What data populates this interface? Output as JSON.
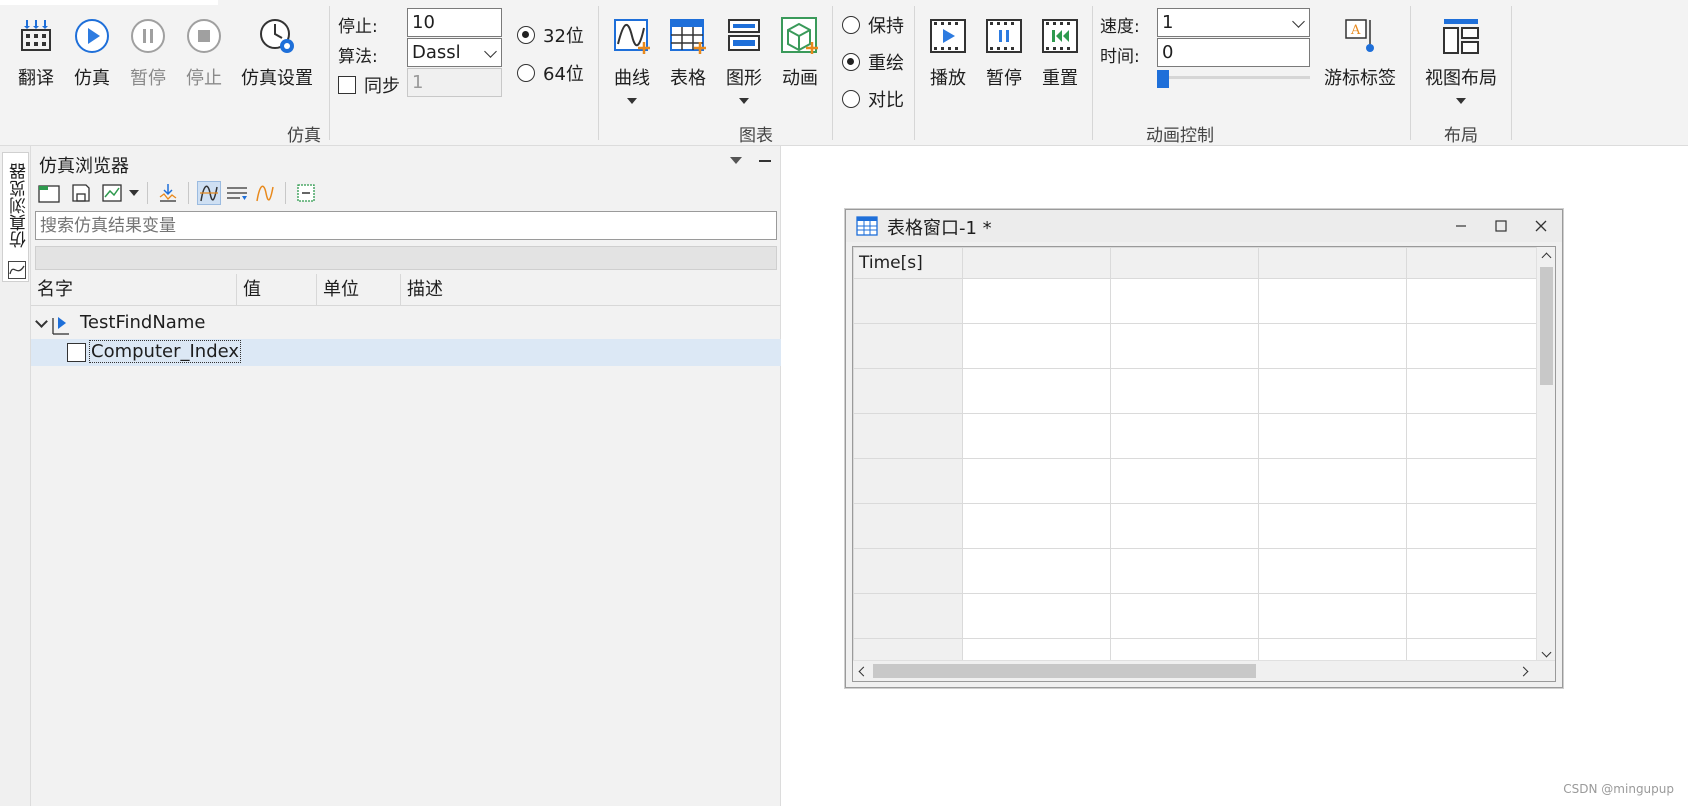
{
  "ribbon": {
    "sim": {
      "translate_label": "翻译",
      "simulate_label": "仿真",
      "pause_label": "暂停",
      "stop_label": "停止",
      "settings_label": "仿真设置",
      "stop_time_label": "停止:",
      "stop_time_value": "10",
      "algorithm_label": "算法:",
      "algorithm_value": "Dassl",
      "sync_label": "同步",
      "sync_value": "1",
      "radio_32": "32位",
      "radio_64": "64位",
      "group_label": "仿真"
    },
    "chart": {
      "curve_label": "曲线",
      "table_label": "表格",
      "graphic_label": "图形",
      "animation_label": "动画",
      "keep_label": "保持",
      "redraw_label": "重绘",
      "compare_label": "对比",
      "group_label": "图表"
    },
    "anim": {
      "play_label": "播放",
      "pause_label": "暂停",
      "reset_label": "重置",
      "speed_label": "速度:",
      "speed_value": "1",
      "time_label": "时间:",
      "time_value": "0",
      "cursor_label": "游标标签",
      "group_label": "动画控制"
    },
    "layout": {
      "view_layout_label": "视图布局",
      "group_label": "布局"
    }
  },
  "side_tab": {
    "label": "仿真浏览器"
  },
  "browser": {
    "title": "仿真浏览器",
    "search_placeholder": "搜索仿真结果变量",
    "columns": [
      "名字",
      "值",
      "单位",
      "描述"
    ],
    "tree": {
      "root": "TestFindName",
      "child": "Computer_Index"
    }
  },
  "table_window": {
    "title": "表格窗口-1 *",
    "first_col_header": "Time[s]"
  },
  "watermark": "CSDN @mingupup"
}
